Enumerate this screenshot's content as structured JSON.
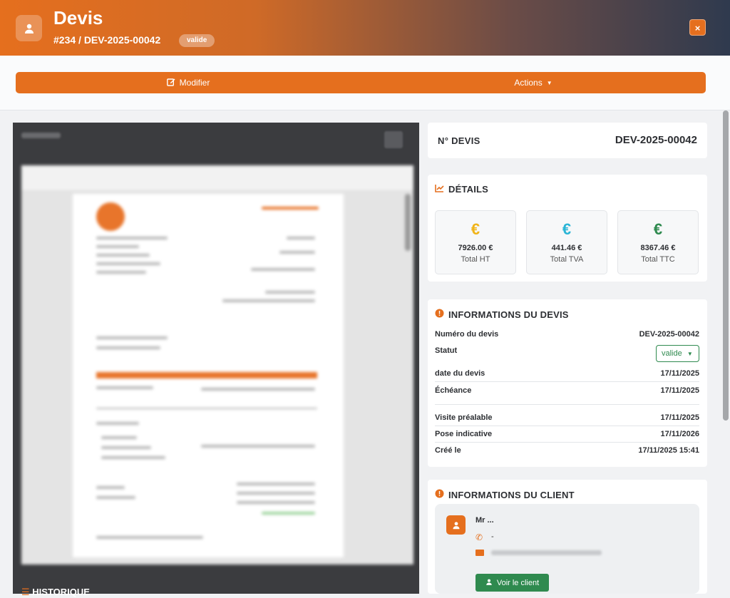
{
  "header": {
    "title": "Devis",
    "subtitle": "#234 / DEV-2025-00042",
    "badge": "valide",
    "close_label": "×"
  },
  "toolbar": {
    "edit_label": "Modifier",
    "actions_label": "Actions"
  },
  "document_panel": {
    "section_label": "HISTORIQUE"
  },
  "quote_number": {
    "label": "N° DEVIS",
    "value": "DEV-2025-00042"
  },
  "details": {
    "title": "DÉTAILS",
    "stats": [
      {
        "icon": "€",
        "value": "7926.00 €",
        "label": "Total HT",
        "color": "#f0b419"
      },
      {
        "icon": "€",
        "value": "441.46 €",
        "label": "Total TVA",
        "color": "#2bb5d6"
      },
      {
        "icon": "€",
        "value": "8367.46 €",
        "label": "Total TTC",
        "color": "#2f8a4f"
      }
    ]
  },
  "info": {
    "title": "INFORMATIONS DU DEVIS",
    "numero_label": "Numéro du devis",
    "numero_value": "DEV-2025-00042",
    "statut_label": "Statut",
    "statut_value": "valide",
    "date_label": "date du devis",
    "date_value": "17/11/2025",
    "echeance_label": "Échéance",
    "echeance_value": "17/11/2025",
    "visite_label": "Visite préalable",
    "visite_value": "17/11/2025",
    "pose_label": "Pose indicative",
    "pose_value": "17/11/2026",
    "cree_label": "Créé le",
    "cree_value": "17/11/2025 15:41"
  },
  "client": {
    "title": "INFORMATIONS DU CLIENT",
    "name": "Mr ...",
    "phone": "-",
    "button_label": "Voir le client"
  },
  "colors": {
    "accent": "#e56f1e",
    "success": "#2f8a4f"
  }
}
